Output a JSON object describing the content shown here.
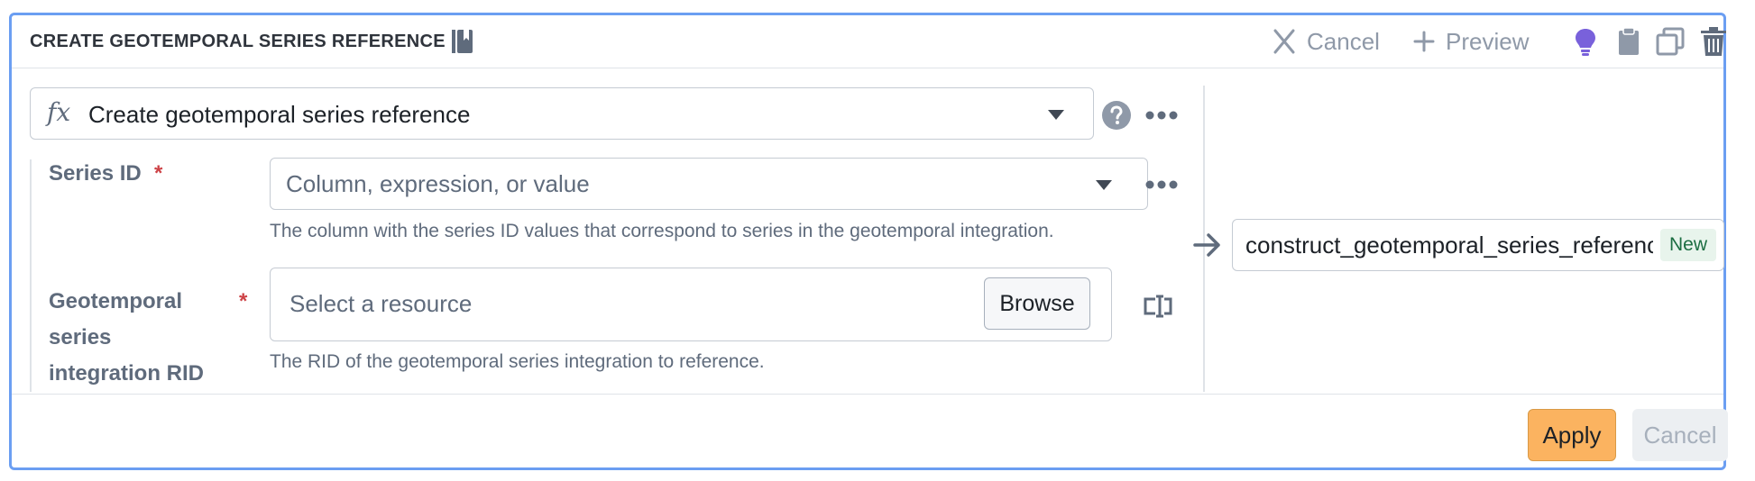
{
  "header": {
    "title": "CREATE GEOTEMPORAL SERIES REFERENCE",
    "cancel_label": "Cancel",
    "preview_label": "Preview",
    "icons": [
      "book-icon",
      "close-icon",
      "plus-icon",
      "lightbulb-icon",
      "clipboard-icon",
      "duplicate-icon",
      "trash-icon"
    ],
    "accent_color": "#7961db"
  },
  "function": {
    "fx_symbol": "fx",
    "selected": "Create geotemporal series reference"
  },
  "fields": [
    {
      "label": "Series ID",
      "required_mark": "*",
      "placeholder": "Column, expression, or value",
      "help": "The column with the series ID values that correspond to series in the geotemporal integration."
    },
    {
      "label_lines": [
        "Geotemporal",
        "series",
        "integration RID"
      ],
      "required_mark": "*",
      "placeholder": "Select a resource",
      "button": "Browse",
      "help": "The RID of the geotemporal series integration to reference."
    }
  ],
  "output": {
    "column_name": "construct_geotemporal_series_reference",
    "badge": "New"
  },
  "footer": {
    "apply_label": "Apply",
    "cancel_label": "Cancel"
  },
  "colors": {
    "border": "#6b9ef2",
    "apply": "#fbb360",
    "required": "#cd4246"
  }
}
